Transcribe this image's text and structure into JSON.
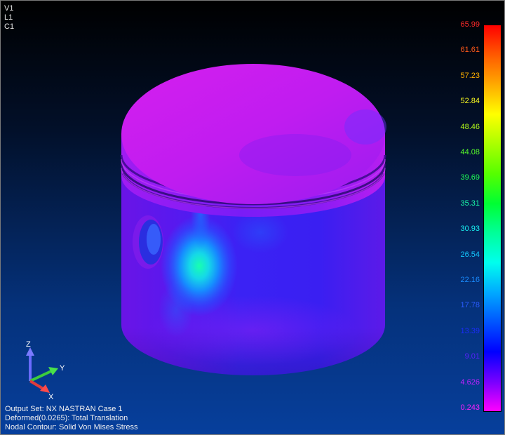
{
  "view_ids": [
    "V1",
    "L1",
    "C1"
  ],
  "legend": {
    "labels": [
      {
        "text": "65.99",
        "color": "#ff2a2a"
      },
      {
        "text": "61.61",
        "color": "#ff5a1a"
      },
      {
        "text": "57.23",
        "color": "#ffb000"
      },
      {
        "text": "52.84",
        "color": "#ffff20"
      },
      {
        "text": "48.46",
        "color": "#b6ff1a"
      },
      {
        "text": "44.08",
        "color": "#58ff2a"
      },
      {
        "text": "39.69",
        "color": "#20ff55"
      },
      {
        "text": "35.31",
        "color": "#1affaa"
      },
      {
        "text": "30.93",
        "color": "#1af2f2"
      },
      {
        "text": "26.54",
        "color": "#14c8ff"
      },
      {
        "text": "22.16",
        "color": "#1a8cff"
      },
      {
        "text": "17.78",
        "color": "#2a5cff"
      },
      {
        "text": "13.39",
        "color": "#1b2cf8"
      },
      {
        "text": "9.01",
        "color": "#5a20ff"
      },
      {
        "text": "4.626",
        "color": "#c020ff"
      },
      {
        "text": "0.243",
        "color": "#ff20ff"
      }
    ]
  },
  "triad": {
    "z": "Z",
    "y": "Y",
    "x": "X"
  },
  "info": {
    "output_set": "Output Set: NX NASTRAN Case 1",
    "deformed": "Deformed(0.0265): Total Translation",
    "contour": "Nodal Contour: Solid Von Mises Stress"
  }
}
